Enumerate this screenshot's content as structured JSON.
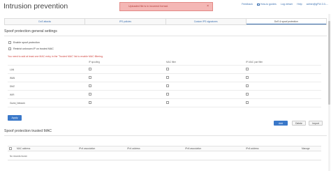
{
  "header": {
    "title": "Intrusion prevention",
    "links": [
      "Feedback",
      "How-to guides",
      "Log viewer",
      "Help",
      "admin@gFW-3.0-..."
    ]
  },
  "alert": {
    "message": "Uploaded file is in incorrect format.",
    "close_glyph": "×"
  },
  "tabs": [
    {
      "label": "DoS attacks",
      "active": false
    },
    {
      "label": "IPS policies",
      "active": false
    },
    {
      "label": "Custom IPS signatures",
      "active": false
    },
    {
      "label": "DoS & spoof protection",
      "active": true
    }
  ],
  "general_settings": {
    "title": "Spoof protection general settings",
    "enable_label": "Enable spoof protection",
    "restrict_label": "Restrict unknown IP on trusted MAC",
    "warning": "You need to add at least one MAC entry in the 'Trusted MAC' list to enable MAC filtering.",
    "columns": [
      "IP spoofing",
      "MAC filter",
      "IP-MAC pair filter"
    ],
    "zones": [
      "LAN",
      "WAN",
      "DMZ",
      "WiFi",
      "Guest_Network"
    ],
    "apply_label": "Apply"
  },
  "trusted_mac": {
    "title": "Spoof protection trusted MAC",
    "add_label": "Add",
    "delete_label": "Delete",
    "import_label": "Import",
    "columns": [
      "MAC address",
      "IPv4 association",
      "IPv4 address",
      "IPv6 association",
      "IPv6 address",
      "Manage"
    ],
    "empty_text": "No records found."
  }
}
